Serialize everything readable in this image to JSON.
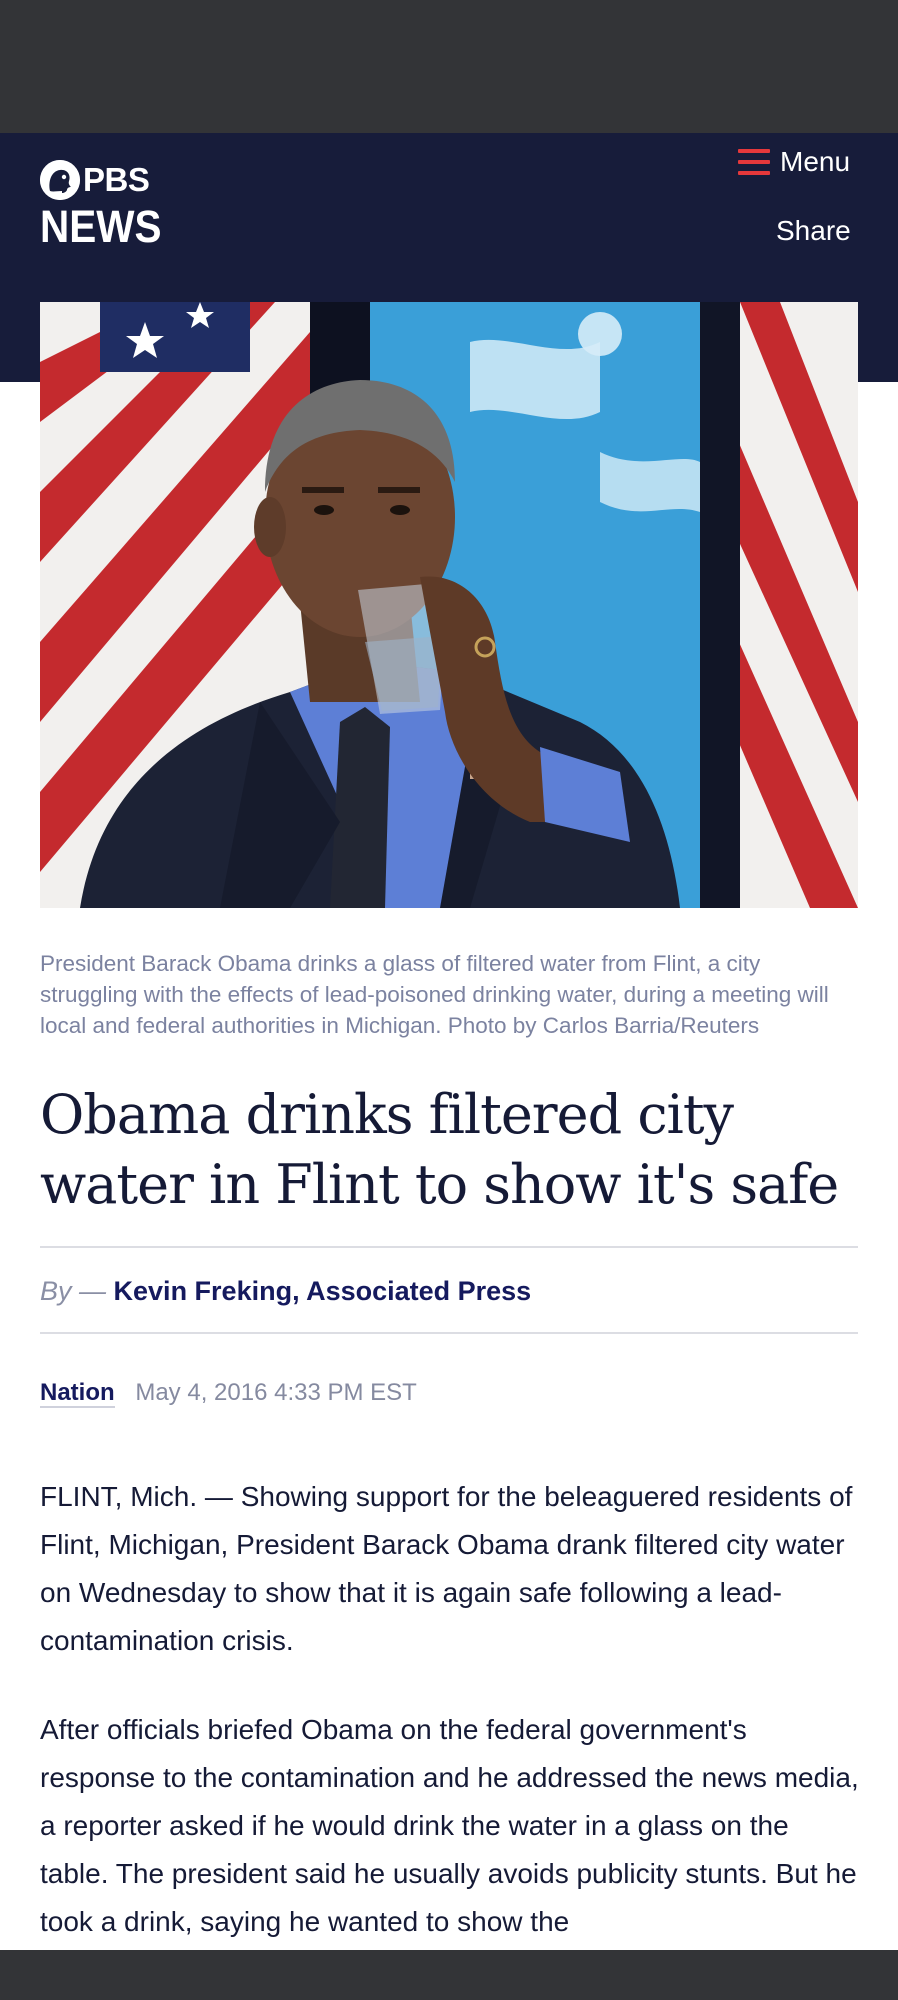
{
  "header": {
    "logo_top": "PBS",
    "logo_bottom": "NEWS",
    "menu_label": "Menu",
    "share_label": "Share"
  },
  "hero": {
    "icon": "photo-obama-drinking-water",
    "caption": "President Barack Obama drinks a glass of filtered water from Flint, a city struggling with the effects of lead-poisoned drinking water, during a meeting will local and federal authorities in Michigan. Photo by Carlos Barria/Reuters"
  },
  "article": {
    "headline": "Obama drinks filtered city water in Flint to show it's safe",
    "by_label": "By —",
    "author": "Kevin Freking, Associated Press",
    "category": "Nation",
    "date": "May 4, 2016 4:33 PM EST",
    "paragraphs": [
      "FLINT, Mich. — Showing support for the beleaguered residents of Flint, Michigan, President Barack Obama drank filtered city water on Wednesday to show that it is again safe following a lead-contamination crisis.",
      "After officials briefed Obama on the federal government's response to the contamination and he addressed the news media, a reporter asked if he would drink the water in a glass on the table. The president said he usually avoids publicity stunts. But he took a drink, saying he wanted to show the"
    ]
  },
  "colors": {
    "top_bar": "#333437",
    "header_bg": "#171c3a",
    "menu_accent": "#e5383b",
    "link_navy": "#151a5e",
    "caption_gray": "#7b82a0"
  }
}
